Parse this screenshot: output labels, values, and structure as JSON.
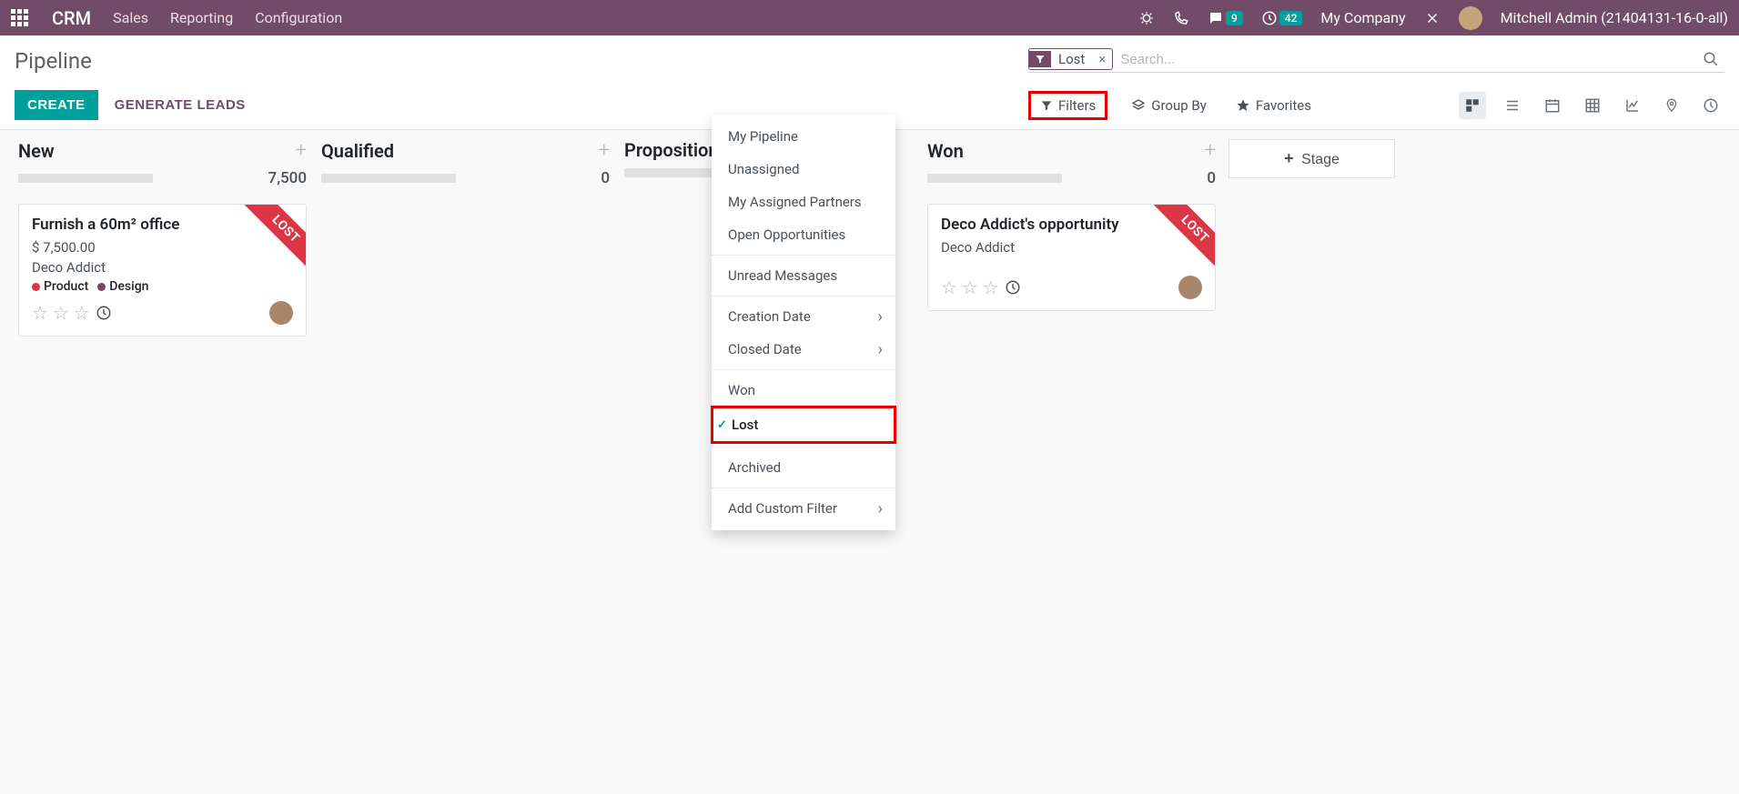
{
  "navbar": {
    "brand": "CRM",
    "links": [
      "Sales",
      "Reporting",
      "Configuration"
    ],
    "messages_badge": "9",
    "clock_badge": "42",
    "company": "My Company",
    "user": "Mitchell Admin (21404131-16-0-all)"
  },
  "control": {
    "title": "Pipeline",
    "create_btn": "CREATE",
    "generate_btn": "GENERATE LEADS",
    "facet_label": "Lost",
    "search_placeholder": "Search...",
    "filters_label": "Filters",
    "groupby_label": "Group By",
    "favorites_label": "Favorites",
    "add_stage": "Stage"
  },
  "dropdown": {
    "items": [
      "My Pipeline",
      "Unassigned",
      "My Assigned Partners",
      "Open Opportunities",
      "Unread Messages",
      "Creation Date",
      "Closed Date",
      "Won",
      "Lost",
      "Archived",
      "Add Custom Filter"
    ]
  },
  "columns": {
    "new": {
      "title": "New",
      "total": "7,500"
    },
    "qualified": {
      "title": "Qualified",
      "total": "0"
    },
    "proposition": {
      "title": "Proposition",
      "total": ""
    },
    "won": {
      "title": "Won",
      "total": "0"
    }
  },
  "cards": {
    "furnish": {
      "title": "Furnish a 60m² office",
      "amount": "$ 7,500.00",
      "customer": "Deco Addict",
      "tag1": "Product",
      "tag2": "Design",
      "ribbon": "LOST"
    },
    "deco": {
      "title": "Deco Addict's opportunity",
      "customer": "Deco Addict",
      "ribbon": "LOST"
    }
  },
  "colors": {
    "tag_product": "#dc3545",
    "tag_design": "#714B67"
  }
}
